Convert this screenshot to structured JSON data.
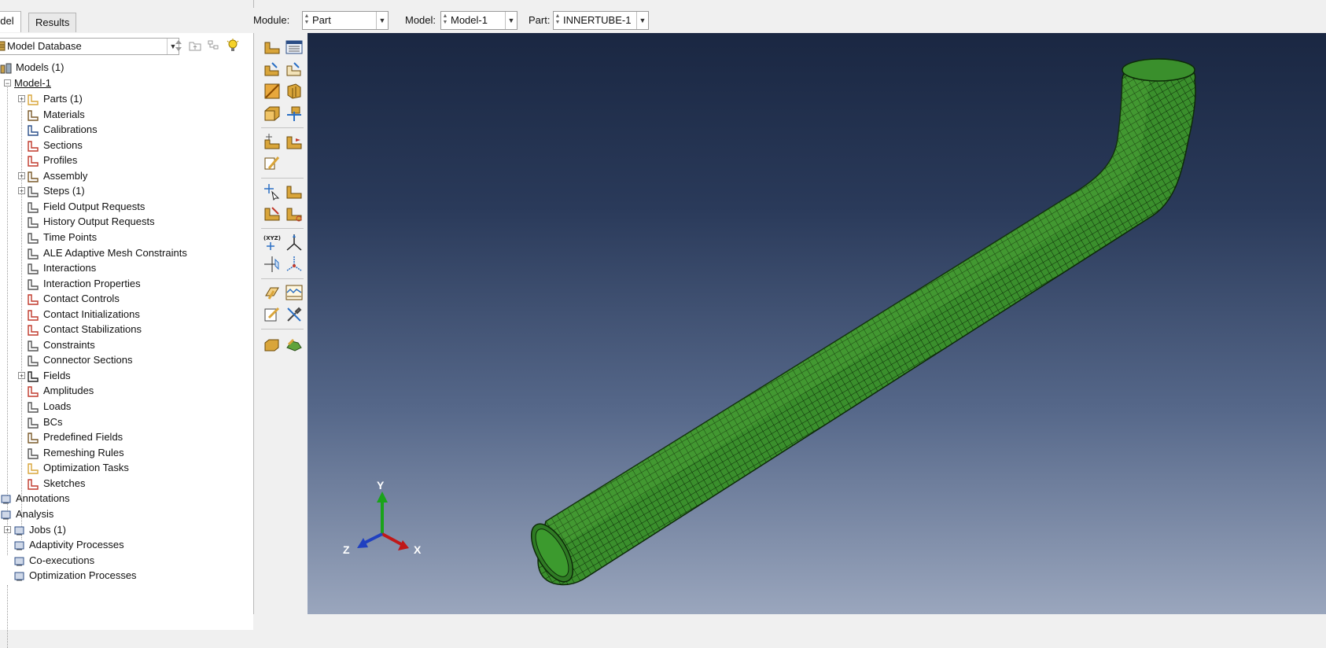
{
  "tabs": {
    "model": "odel",
    "results": "Results"
  },
  "database": {
    "selected": "Model Database"
  },
  "toolbar": {
    "module_label": "Module:",
    "module_value": "Part",
    "model_label": "Model:",
    "model_value": "Model-1",
    "part_label": "Part:",
    "part_value": "INNERTUBE-1"
  },
  "tree": {
    "models": "Models (1)",
    "model1": "Model-1",
    "items": [
      "Parts (1)",
      "Materials",
      "Calibrations",
      "Sections",
      "Profiles",
      "Assembly",
      "Steps (1)",
      "Field Output Requests",
      "History Output Requests",
      "Time Points",
      "ALE Adaptive Mesh Constraints",
      "Interactions",
      "Interaction Properties",
      "Contact Controls",
      "Contact Initializations",
      "Contact Stabilizations",
      "Constraints",
      "Connector Sections",
      "Fields",
      "Amplitudes",
      "Loads",
      "BCs",
      "Predefined Fields",
      "Remeshing Rules",
      "Optimization Tasks",
      "Sketches"
    ],
    "annotations": "Annotations",
    "analysis": "Analysis",
    "analysis_items": [
      "Jobs (1)",
      "Adaptivity Processes",
      "Co-executions",
      "Optimization Processes"
    ]
  },
  "triad": {
    "x": "X",
    "y": "Y",
    "z": "Z"
  },
  "palette": {
    "xyz_label": "(XYZ)"
  },
  "colors": {
    "mesh_green": "#3a8f2c",
    "mesh_line": "#0d2a08",
    "bg_top": "#1a2742",
    "bg_bottom": "#9aa6bd"
  }
}
